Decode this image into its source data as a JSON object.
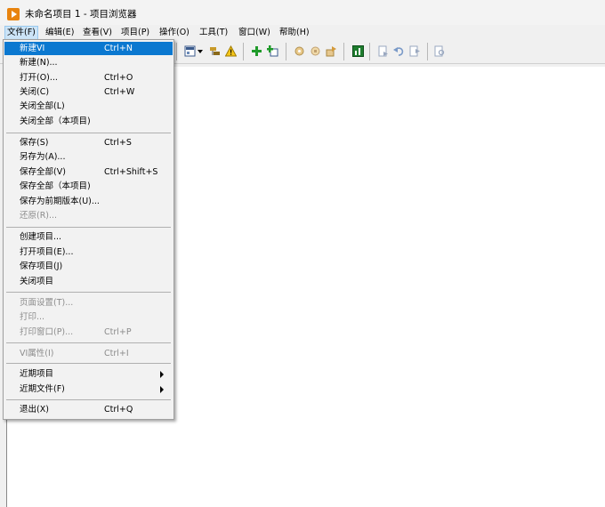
{
  "window": {
    "title": "未命名项目 1 - 项目浏览器"
  },
  "menubar": [
    {
      "label": "文件(F)"
    },
    {
      "label": "编辑(E)"
    },
    {
      "label": "查看(V)"
    },
    {
      "label": "项目(P)"
    },
    {
      "label": "操作(O)"
    },
    {
      "label": "工具(T)"
    },
    {
      "label": "窗口(W)"
    },
    {
      "label": "帮助(H)"
    }
  ],
  "file_menu": [
    {
      "label": "新建VI",
      "shortcut": "Ctrl+N",
      "state": "highlighted"
    },
    {
      "label": "新建(N)...",
      "shortcut": ""
    },
    {
      "label": "打开(O)...",
      "shortcut": "Ctrl+O"
    },
    {
      "label": "关闭(C)",
      "shortcut": "Ctrl+W"
    },
    {
      "label": "关闭全部(L)",
      "shortcut": ""
    },
    {
      "label": "关闭全部（本项目)",
      "shortcut": ""
    },
    {
      "label": "保存(S)",
      "shortcut": "Ctrl+S"
    },
    {
      "label": "另存为(A)...",
      "shortcut": ""
    },
    {
      "label": "保存全部(V)",
      "shortcut": "Ctrl+Shift+S"
    },
    {
      "label": "保存全部（本项目)",
      "shortcut": ""
    },
    {
      "label": "保存为前期版本(U)...",
      "shortcut": ""
    },
    {
      "label": "还原(R)...",
      "shortcut": "",
      "state": "disabled"
    },
    {
      "label": "创建项目...",
      "shortcut": ""
    },
    {
      "label": "打开项目(E)...",
      "shortcut": ""
    },
    {
      "label": "保存项目(J)",
      "shortcut": ""
    },
    {
      "label": "关闭项目",
      "shortcut": ""
    },
    {
      "label": "页面设置(T)...",
      "shortcut": "",
      "state": "disabled"
    },
    {
      "label": "打印...",
      "shortcut": "",
      "state": "disabled"
    },
    {
      "label": "打印窗口(P)...",
      "shortcut": "Ctrl+P",
      "state": "disabled"
    },
    {
      "label": "VI属性(I)",
      "shortcut": "Ctrl+I",
      "state": "disabled"
    },
    {
      "label": "近期项目",
      "shortcut": "",
      "submenu": true
    },
    {
      "label": "近期文件(F)",
      "shortcut": "",
      "submenu": true
    },
    {
      "label": "退出(X)",
      "shortcut": "Ctrl+Q"
    }
  ],
  "toolbar_icons": [
    "new-vi-icon",
    "dropdown-arrow-icon",
    "properties-icon",
    "warning-icon",
    "add-green-icon",
    "add-file-icon",
    "build-icon",
    "build-settings-icon",
    "deploy-icon",
    "chart-icon",
    "doc-icon",
    "undo-icon",
    "redo-icon",
    "find-icon"
  ],
  "colors": {
    "highlight": "#0b78d0",
    "menu_bg": "#f2f2f2",
    "disabled_text": "#8c8c8c",
    "app_icon": "#e8830e"
  }
}
